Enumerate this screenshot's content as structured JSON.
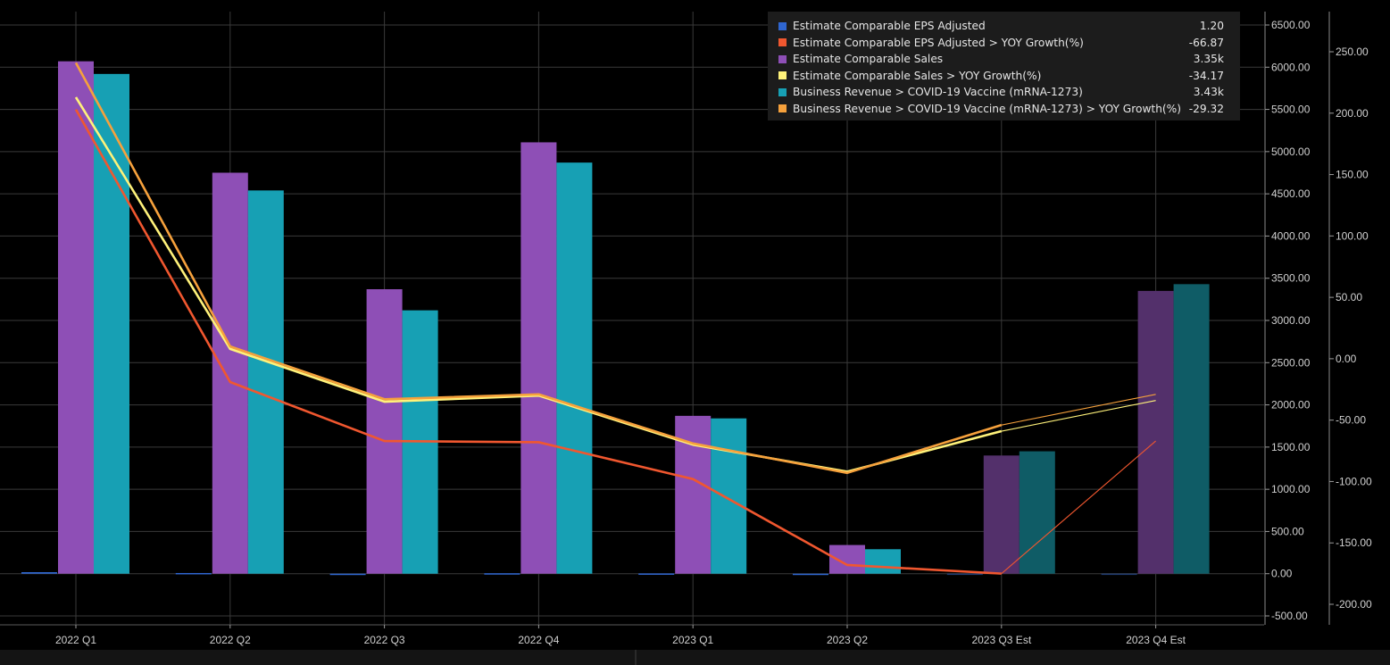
{
  "chart_data": {
    "type": "bar",
    "categories": [
      "2022 Q1",
      "2022 Q2",
      "2022 Q3",
      "2022 Q4",
      "2023 Q1",
      "2023 Q2",
      "2023 Q3 Est",
      "2023 Q4 Est"
    ],
    "estimate_categories": [
      "2023 Q3 Est",
      "2023 Q4 Est"
    ],
    "left_axis": {
      "ylim": [
        -500,
        6500
      ],
      "ticks": [
        "6500.00",
        "6000.00",
        "5500.00",
        "5000.00",
        "4500.00",
        "4000.00",
        "3500.00",
        "3000.00",
        "2500.00",
        "2000.00",
        "1500.00",
        "1000.00",
        "500.00",
        "0.00",
        "-500.00"
      ]
    },
    "right_axis": {
      "ylim": [
        -200,
        250
      ],
      "ticks": [
        "250.00",
        "200.00",
        "150.00",
        "100.00",
        "50.00",
        "0.00",
        "-50.00",
        "-100.00",
        "-150.00",
        "-200.00"
      ]
    },
    "grid": true,
    "legend_position": "top-right",
    "series": [
      {
        "name": "Estimate Comparable EPS Adjusted",
        "type": "bar",
        "axis": "left",
        "color": "#2f66d0",
        "last": "1.20",
        "values": [
          18,
          8,
          -4,
          5,
          3,
          -4,
          1.2,
          1.2
        ]
      },
      {
        "name": "Estimate Comparable EPS Adjusted > YOY Growth(%)",
        "type": "line",
        "axis": "right",
        "color": "#f0572f",
        "last": "-66.87",
        "values": [
          203,
          -19,
          -67,
          -68,
          -98,
          -168,
          -175,
          -67
        ]
      },
      {
        "name": "Estimate Comparable Sales",
        "type": "bar",
        "axis": "left",
        "color": "#8e4fb6",
        "last": "3.35k",
        "values": [
          6070,
          4750,
          3370,
          5110,
          1870,
          340,
          1400,
          3350
        ]
      },
      {
        "name": "Estimate Comparable Sales > YOY Growth(%)",
        "type": "line",
        "axis": "right",
        "color": "#fff27a",
        "last": "-34.17",
        "values": [
          213,
          8,
          -35,
          -30,
          -70,
          -92,
          -59,
          -34
        ]
      },
      {
        "name": "Business Revenue > COVID-19 Vaccine (mRNA-1273)",
        "type": "bar",
        "axis": "left",
        "color": "#17a0b4",
        "last": "3.43k",
        "values": [
          5920,
          4540,
          3120,
          4870,
          1840,
          290,
          1450,
          3430
        ]
      },
      {
        "name": "Business Revenue > COVID-19 Vaccine (mRNA-1273) > YOY Growth(%)",
        "type": "line",
        "axis": "right",
        "color": "#f6a13c",
        "last": "-29.32",
        "values": [
          241,
          10,
          -33,
          -29,
          -69,
          -93,
          -54,
          -29
        ]
      }
    ]
  }
}
